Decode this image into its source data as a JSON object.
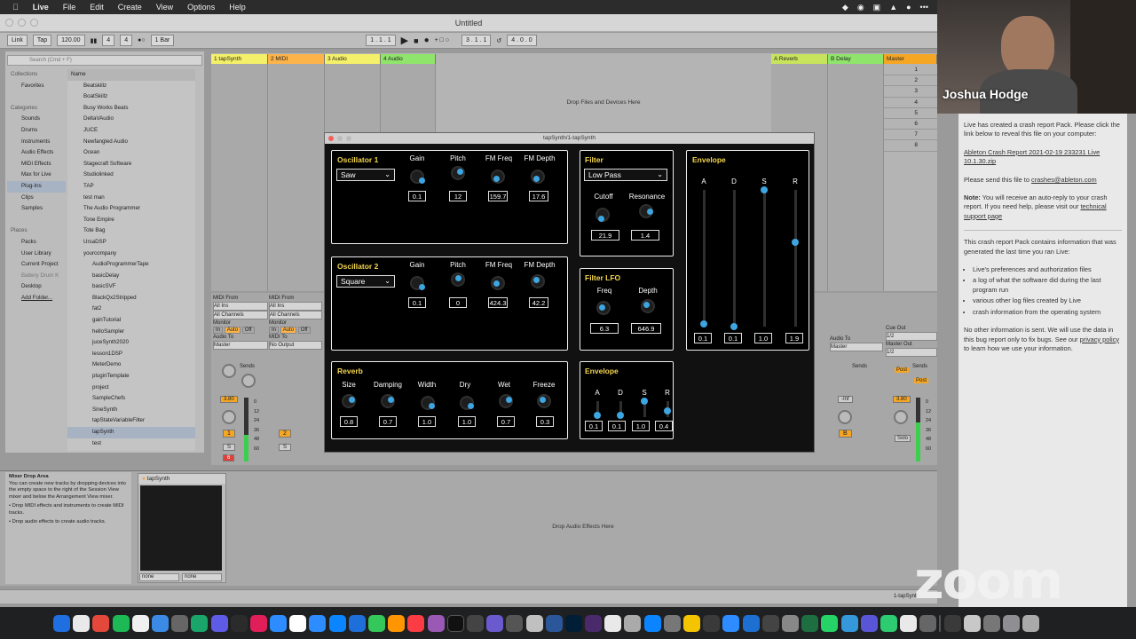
{
  "menubar": {
    "app": "Live",
    "items": [
      "File",
      "Edit",
      "Create",
      "View",
      "Options",
      "Help"
    ]
  },
  "window": {
    "title": "Untitled"
  },
  "control": {
    "link": "Link",
    "tap": "Tap",
    "tempo": "120.00",
    "sig_num": "4",
    "sig_den": "4",
    "quant": "1 Bar",
    "position": "1 .  1 .  1",
    "loop_start": "3 .  1 .  1",
    "loop_len": "4 .  0 .  0"
  },
  "browser": {
    "search_placeholder": "Search (Cmd + F)",
    "collections_header": "Collections",
    "favorites": "Favorites",
    "categories_header": "Categories",
    "categories": [
      "Sounds",
      "Drums",
      "Instruments",
      "Audio Effects",
      "MIDI Effects",
      "Max for Live",
      "Plug-Ins",
      "Clips",
      "Samples"
    ],
    "places_header": "Places",
    "places": [
      "Packs",
      "User Library",
      "Current Project",
      "Battery Drum K",
      "Desktop",
      "Add Folder..."
    ],
    "name_header": "Name",
    "items": [
      "Beatskillz",
      "BoatSkillz",
      "Busy Works Beats",
      "DeltaVAudio",
      "JUCE",
      "Newfangled Audio",
      "Ocean",
      "Stagecraft Software",
      "Studiolinked",
      "TAP",
      "test man",
      "The Audio Programmer",
      "Tone Empire",
      "Tote Bag",
      "UrsaDSP",
      "yourcompany",
      "AudioProgrammerTape",
      "basicDelay",
      "basicSVF",
      "BlackQx2Stripped",
      "fat2",
      "gainTutorial",
      "helloSampler",
      "juceSynth2020",
      "lesson1DSP",
      "MeterDemo",
      "pluginTemplate",
      "project",
      "SampleChefs",
      "SineSynth",
      "tapStateVariableFilter",
      "tapSynth",
      "test"
    ]
  },
  "tracks": [
    {
      "name": "1 tapSynth",
      "color": "#f5f069"
    },
    {
      "name": "2 MIDI",
      "color": "#fbb34a"
    },
    {
      "name": "3 Audio",
      "color": "#f5f069"
    },
    {
      "name": "4 Audio",
      "color": "#8fe46b"
    }
  ],
  "returns": [
    {
      "name": "A Reverb",
      "color": "#c8e45c"
    },
    {
      "name": "B Delay",
      "color": "#8fe46b"
    },
    {
      "name": "Master",
      "color": "#f5a623"
    }
  ],
  "scenes": [
    "1",
    "2",
    "3",
    "4",
    "5",
    "6",
    "7",
    "8"
  ],
  "drop_files": "Drop Files and Devices Here",
  "io": {
    "midi_from": "MIDI From",
    "all_ins": "All Ins",
    "all_channels": "All Channels",
    "monitor": "Monitor",
    "in": "In",
    "auto": "Auto",
    "off": "Off",
    "audio_to": "Audio To",
    "master": "Master",
    "midi_to": "MIDI To",
    "no_output": "No Output",
    "cue_out": "Cue Out",
    "cue_val": "1/2",
    "master_out": "Master Out",
    "master_val": "1/2",
    "sends": "Sends",
    "post": "Post",
    "solo": "Solo"
  },
  "mixer": {
    "vol1": "3.80",
    "vol_master": "3.80",
    "vol_inf": "-Inf",
    "track1": "1",
    "track2": "2",
    "track_b": "B",
    "s": "S",
    "rec": "6",
    "db": [
      "0",
      "12",
      "24",
      "36",
      "48",
      "60"
    ]
  },
  "plugin": {
    "title": "tapSynth/1-tapSynth",
    "osc1": {
      "title": "Oscillator 1",
      "wave": "Saw",
      "labels": [
        "Gain",
        "Pitch",
        "FM Freq",
        "FM Depth"
      ],
      "values": [
        "0.1",
        "12",
        "159.7",
        "17.6"
      ]
    },
    "osc2": {
      "title": "Oscillator 2",
      "wave": "Square",
      "labels": [
        "Gain",
        "Pitch",
        "FM Freq",
        "FM Depth"
      ],
      "values": [
        "0.1",
        "0",
        "424.3",
        "42.2"
      ]
    },
    "reverb": {
      "title": "Reverb",
      "labels": [
        "Size",
        "Damping",
        "Width",
        "Dry",
        "Wet",
        "Freeze"
      ],
      "values": [
        "0.8",
        "0.7",
        "1.0",
        "1.0",
        "0.7",
        "0.3"
      ]
    },
    "filter": {
      "title": "Filter",
      "type": "Low Pass",
      "labels": [
        "Cutoff",
        "Resonance"
      ],
      "values": [
        "21.9",
        "1.4"
      ]
    },
    "filter_lfo": {
      "title": "Filter LFO",
      "labels": [
        "Freq",
        "Depth"
      ],
      "values": [
        "6.3",
        "646.9"
      ]
    },
    "fenv": {
      "title": "Envelope",
      "labels": [
        "A",
        "D",
        "S",
        "R"
      ],
      "values": [
        "0.1",
        "0.1",
        "1.0",
        "0.4"
      ],
      "levels": [
        0.1,
        0.1,
        1.0,
        0.4
      ]
    },
    "amp_env": {
      "title": "Envelope",
      "labels": [
        "A",
        "D",
        "S",
        "R"
      ],
      "values": [
        "0.1",
        "0.1",
        "1.0",
        "1.9"
      ],
      "levels": [
        0.02,
        0.0,
        1.0,
        0.62
      ]
    }
  },
  "detail": {
    "info_title": "Mixer Drop Area",
    "info_text": "You can create new tracks by dropping devices into the empty space to the right of the Session View mixer and below the Arrangement View mixer.",
    "info_bullets": [
      "Drop MIDI effects and instruments to create MIDI tracks.",
      "Drop audio effects to create audio tracks."
    ],
    "device_name": "tapSynth",
    "none1": "none",
    "none2": "none",
    "drop_audio": "Drop Audio Effects Here",
    "status_right": "1-tapSynth"
  },
  "webcam": {
    "name": "Joshua Hodge"
  },
  "crash": {
    "p1": "Live has created a crash report Pack. Please click the link below to reveal this file on your computer:",
    "link": "Ableton Crash Report 2021-02-19 233231 Live 10.1.30.zip",
    "p2_pre": "Please send this file to ",
    "email": "crashes@ableton.com",
    "note_label": "Note:",
    "note": " You will receive an auto-reply to your crash report. If you need help, please visit our ",
    "support": "technical support page",
    "p4": "This crash report Pack contains information that was generated the last time you ran Live:",
    "bullets": [
      "Live's preferences and authorization files",
      "a log of what the software did during the last program run",
      "various other log files created by Live",
      "crash information from the operating system"
    ],
    "p5_pre": "No other information is sent. We will use the data in this bug report only to fix bugs. See our ",
    "privacy": "privacy policy",
    "p5_post": " to learn how we use your information."
  },
  "zoom_logo": "zoom",
  "colors": {
    "knob": "#3da5e0",
    "panel_title": "#f4d64e"
  }
}
